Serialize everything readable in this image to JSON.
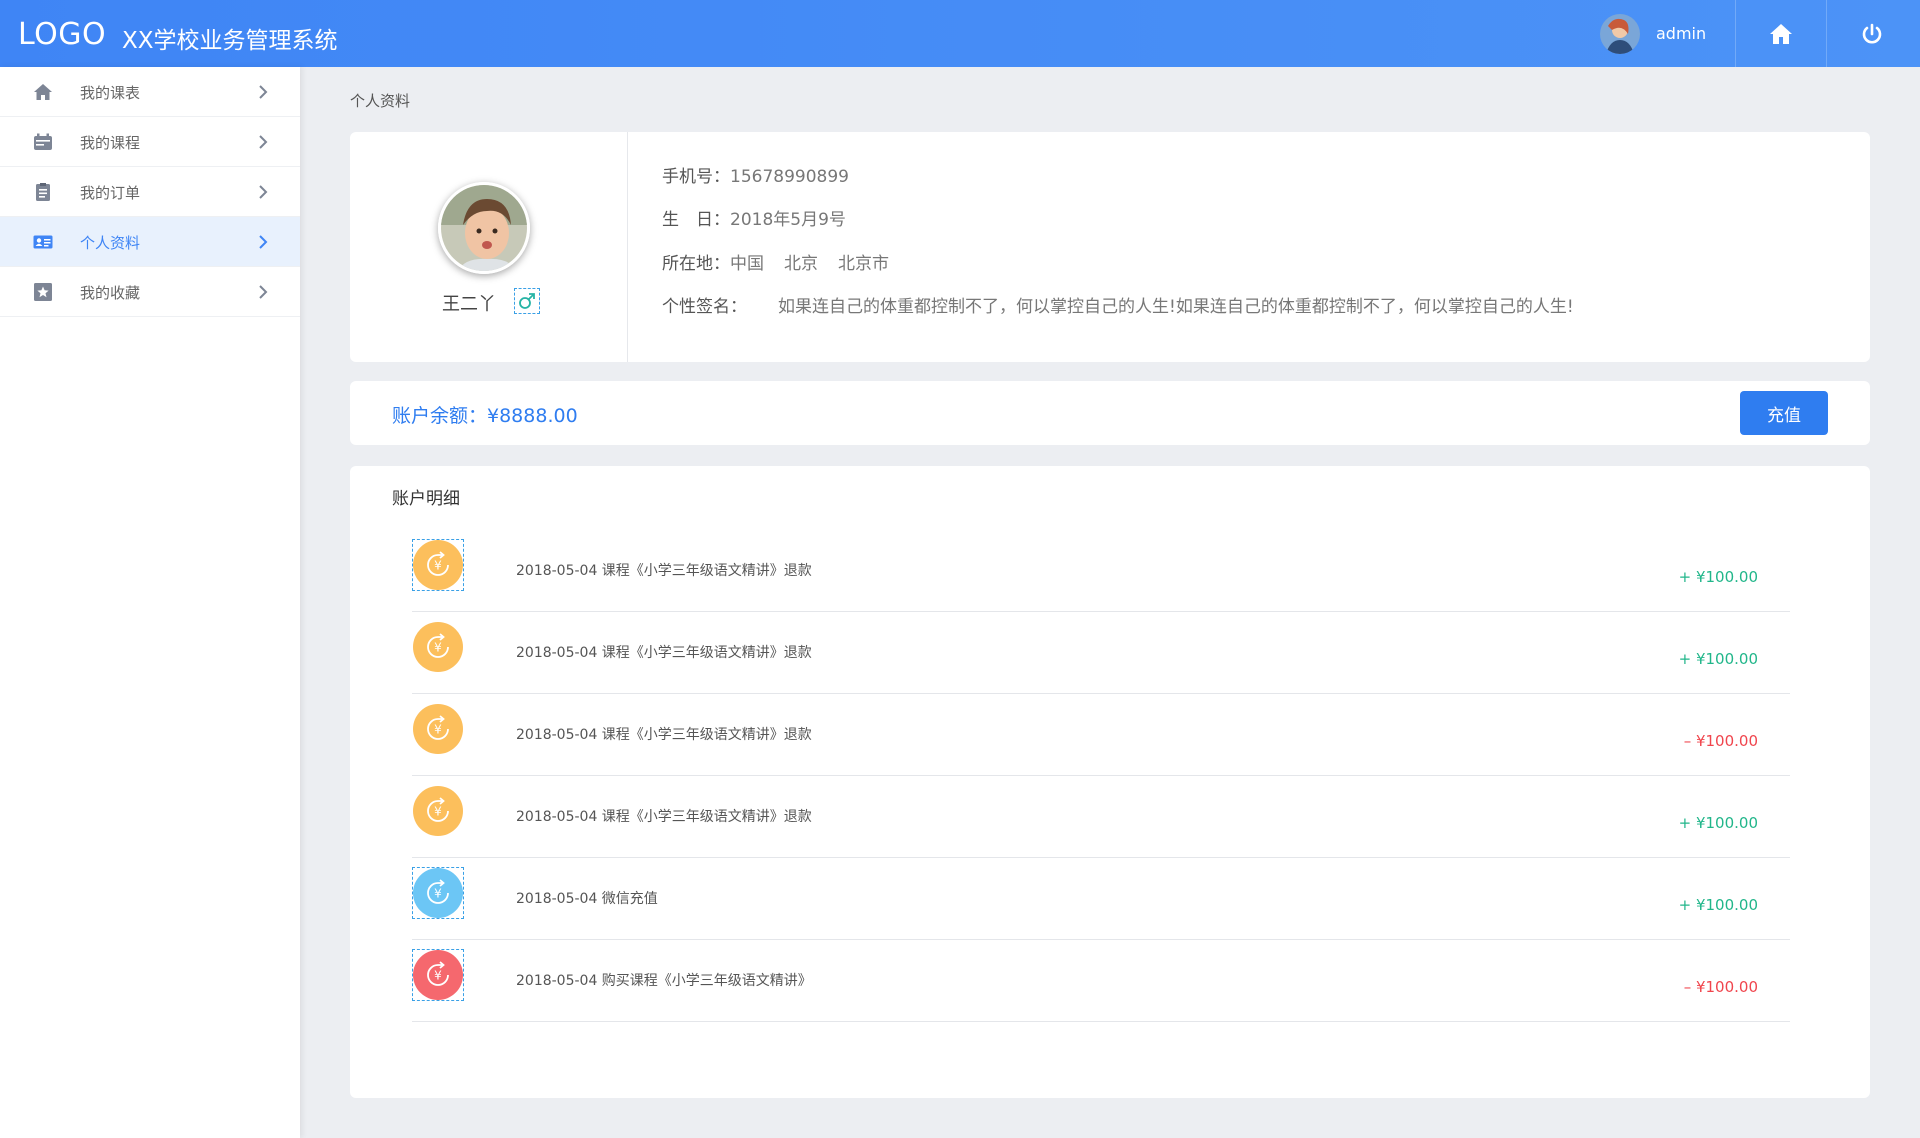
{
  "header": {
    "logo": "LOGO",
    "title": "XX学校业务管理系统",
    "user_name": "admin"
  },
  "sidebar": {
    "items": [
      {
        "label": "我的课表",
        "icon": "home-icon"
      },
      {
        "label": "我的课程",
        "icon": "calendar-icon"
      },
      {
        "label": "我的订单",
        "icon": "clipboard-icon"
      },
      {
        "label": "个人资料",
        "icon": "id-card-icon",
        "active": true
      },
      {
        "label": "我的收藏",
        "icon": "star-icon"
      }
    ]
  },
  "breadcrumb": "个人资料",
  "profile": {
    "name": "王二丫",
    "gender_symbol": "♂",
    "phone_label": "手机号：",
    "phone": "15678990899",
    "birthday_label": "生　日：",
    "birthday": "2018年5月9号",
    "location_label": "所在地：",
    "location": [
      "中国",
      "北京",
      "北京市"
    ],
    "signature_label": "个性签名：",
    "signature": "如果连自己的体重都控制不了，何以掌控自己的人生!如果连自己的体重都控制不了，何以掌控自己的人生!"
  },
  "balance": {
    "text": "账户余额：¥8888.00",
    "recharge_label": "充值"
  },
  "details": {
    "title": "账户明细",
    "rows": [
      {
        "desc": "2018-05-04 课程《小学三年级语文精讲》退款",
        "amount": "+ ¥100.00",
        "type": "refund",
        "sign": "plus"
      },
      {
        "desc": "2018-05-04 课程《小学三年级语文精讲》退款",
        "amount": "+ ¥100.00",
        "type": "refund",
        "sign": "plus"
      },
      {
        "desc": "2018-05-04 课程《小学三年级语文精讲》退款",
        "amount": "– ¥100.00",
        "type": "refund",
        "sign": "minus"
      },
      {
        "desc": "2018-05-04 课程《小学三年级语文精讲》退款",
        "amount": "+ ¥100.00",
        "type": "refund",
        "sign": "plus"
      },
      {
        "desc": "2018-05-04 微信充值",
        "amount": "+ ¥100.00",
        "type": "recharge",
        "sign": "plus"
      },
      {
        "desc": "2018-05-04 购买课程《小学三年级语文精讲》",
        "amount": "– ¥100.00",
        "type": "purchase",
        "sign": "minus"
      }
    ]
  },
  "colors": {
    "accent": "#3f85f5",
    "refund_icon": "#fcbf5c",
    "recharge_icon": "#6cc6f5",
    "purchase_icon": "#f5686e",
    "plus": "#21b68a",
    "minus": "#f0454d"
  }
}
